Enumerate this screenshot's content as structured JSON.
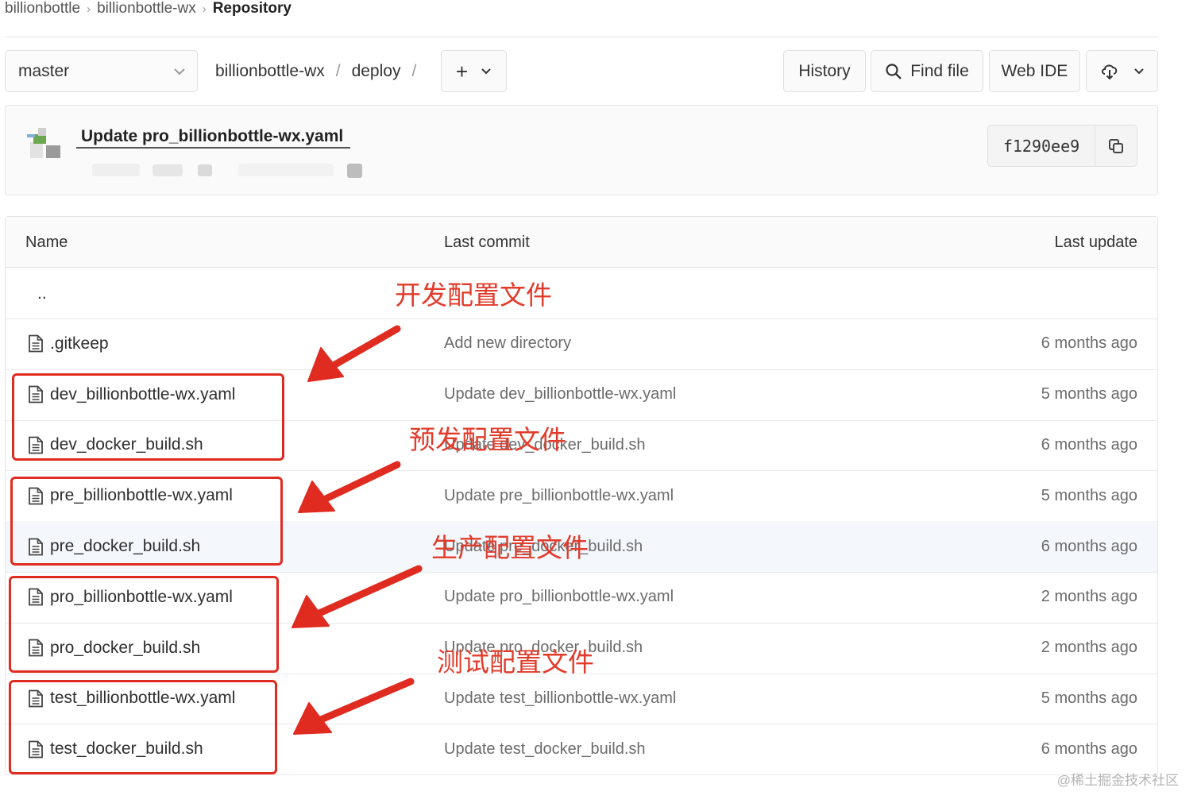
{
  "breadcrumb": {
    "items": [
      "billionbottle",
      "billionbottle-wx"
    ],
    "current": "Repository"
  },
  "toolbar": {
    "branch": "master",
    "path": {
      "repo": "billionbottle-wx",
      "dir": "deploy",
      "separator": "/"
    },
    "add_label": "+",
    "history_label": "History",
    "find_file_label": "Find file",
    "web_ide_label": "Web IDE"
  },
  "commit": {
    "title": "Update pro_billionbottle-wx.yaml",
    "sha": "f1290ee9"
  },
  "table": {
    "headers": {
      "name": "Name",
      "last_commit": "Last commit",
      "last_update": "Last update"
    },
    "parent": "..",
    "rows": [
      {
        "name": ".gitkeep",
        "commit": "Add new directory",
        "updated": "6 months ago"
      },
      {
        "name": "dev_billionbottle-wx.yaml",
        "commit": "Update dev_billionbottle-wx.yaml",
        "updated": "5 months ago"
      },
      {
        "name": "dev_docker_build.sh",
        "commit": "Update dev_docker_build.sh",
        "updated": "6 months ago"
      },
      {
        "name": "pre_billionbottle-wx.yaml",
        "commit": "Update pre_billionbottle-wx.yaml",
        "updated": "5 months ago"
      },
      {
        "name": "pre_docker_build.sh",
        "commit": "Update pre_docker_build.sh",
        "updated": "6 months ago"
      },
      {
        "name": "pro_billionbottle-wx.yaml",
        "commit": "Update pro_billionbottle-wx.yaml",
        "updated": "2 months ago"
      },
      {
        "name": "pro_docker_build.sh",
        "commit": "Update pro_docker_build.sh",
        "updated": "2 months ago"
      },
      {
        "name": "test_billionbottle-wx.yaml",
        "commit": "Update test_billionbottle-wx.yaml",
        "updated": "5 months ago"
      },
      {
        "name": "test_docker_build.sh",
        "commit": "Update test_docker_build.sh",
        "updated": "6 months ago"
      }
    ]
  },
  "annotations": {
    "dev": "开发配置文件",
    "pre": "预发配置文件",
    "pro": "生产配置文件",
    "test": "测试配置文件",
    "color": "#e02b20"
  },
  "watermark": "@稀土掘金技术社区",
  "icons": [
    "chevron-down-icon",
    "search-icon",
    "cloud-download-icon",
    "copy-icon",
    "file-icon",
    "arrow-icon"
  ]
}
